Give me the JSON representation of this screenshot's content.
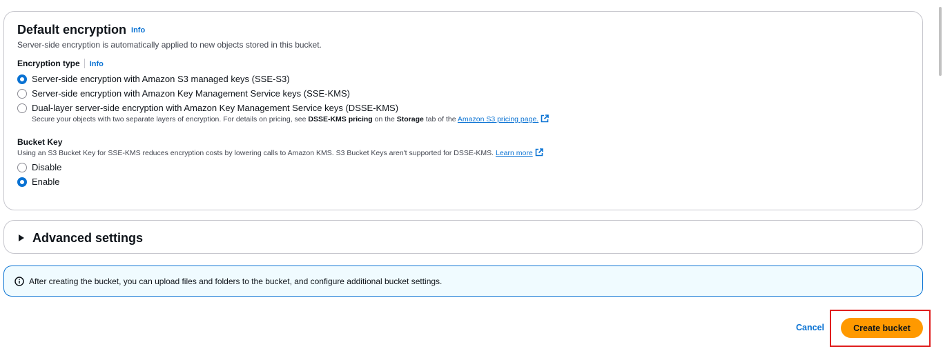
{
  "encryption": {
    "title": "Default encryption",
    "info": "Info",
    "description": "Server-side encryption is automatically applied to new objects stored in this bucket.",
    "type_label": "Encryption type",
    "type_info": "Info",
    "options": [
      {
        "label": "Server-side encryption with Amazon S3 managed keys (SSE-S3)",
        "selected": true
      },
      {
        "label": "Server-side encryption with Amazon Key Management Service keys (SSE-KMS)",
        "selected": false
      },
      {
        "label": "Dual-layer server-side encryption with Amazon Key Management Service keys (DSSE-KMS)",
        "selected": false
      }
    ],
    "dsse_desc_pre": "Secure your objects with two separate layers of encryption. For details on pricing, see ",
    "dsse_desc_bold": "DSSE-KMS pricing",
    "dsse_desc_mid": " on the ",
    "dsse_desc_bold2": "Storage",
    "dsse_desc_post": " tab of the ",
    "dsse_link": "Amazon S3 pricing page."
  },
  "bucket_key": {
    "label": "Bucket Key",
    "description": "Using an S3 Bucket Key for SSE-KMS reduces encryption costs by lowering calls to Amazon KMS. S3 Bucket Keys aren't supported for DSSE-KMS.",
    "learn_more": "Learn more",
    "options": [
      {
        "label": "Disable",
        "selected": false
      },
      {
        "label": "Enable",
        "selected": true
      }
    ]
  },
  "advanced": {
    "title": "Advanced settings"
  },
  "alert": {
    "text": "After creating the bucket, you can upload files and folders to the bucket, and configure additional bucket settings."
  },
  "footer": {
    "cancel": "Cancel",
    "create": "Create bucket"
  },
  "colors": {
    "accent": "#0972d3",
    "primary_button": "#ff9900",
    "highlight": "#e01e1e"
  },
  "icons": {
    "external": "external-link-icon",
    "info": "info-circle-icon",
    "caret": "caret-right-icon"
  }
}
